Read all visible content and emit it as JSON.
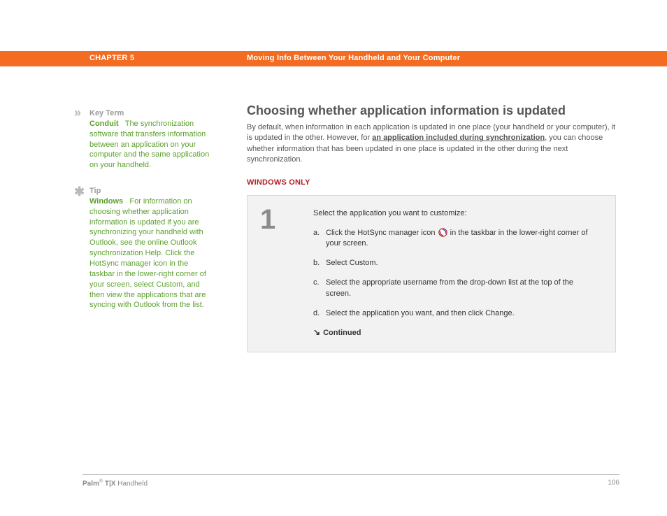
{
  "banner": {
    "chapter": "CHAPTER 5",
    "title": "Moving Info Between Your Handheld and Your Computer"
  },
  "sidebar": {
    "keyterm": {
      "head": "Key Term",
      "label": "Conduit",
      "text": "The synchronization software that transfers information between an application on your computer and the same application on your handheld."
    },
    "tip": {
      "head": "Tip",
      "label": "Windows",
      "text": "For information on choosing whether application information is updated if you are synchronizing your handheld with Outlook, see the online Outlook synchronization Help. Click the HotSync manager icon in the taskbar in the lower-right corner of your screen, select Custom, and then view the applications that are syncing with Outlook from the list."
    }
  },
  "main": {
    "heading": "Choosing whether application information is updated",
    "intro_pre": "By default, when information in each application is updated in one place (your handheld or your computer), it is updated in the other. However, for ",
    "intro_link": "an application included during synchronization",
    "intro_post": ", you can choose whether information that has been updated in one place is updated in the other during the next synchronization.",
    "platform": "WINDOWS ONLY",
    "step": {
      "num": "1",
      "lead": "Select the application you want to customize:",
      "a_pre": "Click the HotSync manager icon ",
      "a_post": " in the taskbar in the lower-right corner of your screen.",
      "b": "Select Custom.",
      "c": "Select the appropriate username from the drop-down list at the top of the screen.",
      "d": "Select the application you want, and then click Change.",
      "continued": "Continued",
      "letters": {
        "a": "a.",
        "b": "b.",
        "c": "c.",
        "d": "d."
      }
    }
  },
  "footer": {
    "brand_strong": "Palm",
    "brand_reg": "®",
    "brand_model": " T|X",
    "brand_tail": " Handheld",
    "page": "106"
  }
}
